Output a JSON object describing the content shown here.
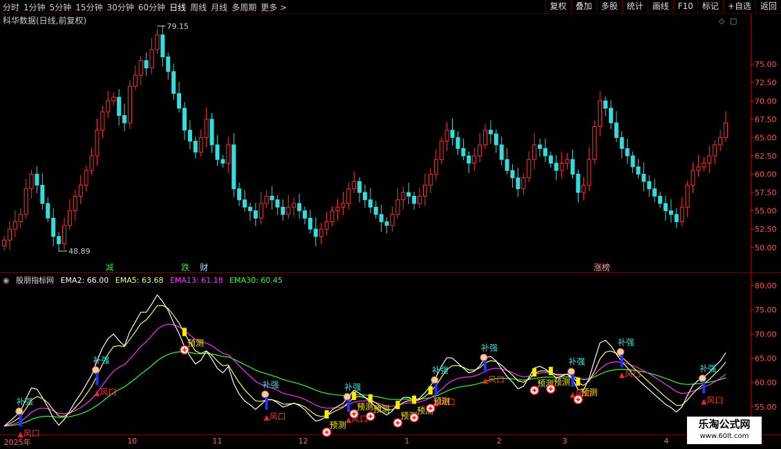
{
  "toolbar": {
    "periods": [
      "分时",
      "1分钟",
      "5分钟",
      "15分钟",
      "30分钟",
      "60分钟",
      "日线",
      "周线",
      "月线",
      "多周期",
      "更多 >"
    ],
    "active": "日线",
    "right_buttons": [
      "复权",
      "叠加",
      "多股",
      "统计",
      "画线",
      "F10",
      "标记",
      "+自选",
      "返回"
    ]
  },
  "chart_title": "科华数据(日线,前复权)",
  "price_high_label": "79.15",
  "price_low_label": "48.89",
  "price_axis_ticks": [
    "75.00",
    "72.50",
    "70.00",
    "67.50",
    "65.00",
    "62.50",
    "60.00",
    "57.50",
    "55.00",
    "52.50",
    "50.00"
  ],
  "indicator_axis_ticks": [
    "80.00",
    "75.00",
    "70.00",
    "65.00",
    "60.00",
    "55.00"
  ],
  "events": [
    {
      "label": "减",
      "color": "#33dd33",
      "x": 0.135
    },
    {
      "label": "跌",
      "color": "#33dd33",
      "x": 0.232
    },
    {
      "label": "财",
      "color": "#aaddff",
      "x": 0.256
    },
    {
      "label": "涨榜",
      "color": "#ff9999",
      "x": 0.76
    }
  ],
  "indicator": {
    "name": "股朋指标网",
    "ema2_label": "EMA2: 66.00",
    "ema5_label": "EMA5: 63.68",
    "ema13_label": "EMA13: 61.18",
    "ema30_label": "EMA30: 60.45"
  },
  "signal_texts": {
    "bu": "补强",
    "feng": "风口",
    "yu": "预测"
  },
  "x_axis_labels": [
    {
      "text": "2025年",
      "x": 0.005
    },
    {
      "text": "10",
      "x": 0.163
    },
    {
      "text": "11",
      "x": 0.272
    },
    {
      "text": "12",
      "x": 0.382
    },
    {
      "text": "1",
      "x": 0.518
    },
    {
      "text": "2",
      "x": 0.636
    },
    {
      "text": "3",
      "x": 0.72
    },
    {
      "text": "4",
      "x": 0.85
    }
  ],
  "colors": {
    "up": "#ff3333",
    "down": "#33dddd",
    "ema2": "#ffffff",
    "ema5": "#ffff66",
    "ema13": "#ff33ff",
    "ema30": "#33ff33"
  },
  "chart_data": {
    "type": "candlestick",
    "price_range": [
      48.89,
      79.15
    ],
    "closes": [
      51.0,
      52.5,
      53.5,
      54.5,
      58.0,
      60.0,
      58.5,
      56.0,
      54.0,
      51.5,
      50.5,
      53.0,
      55.0,
      57.0,
      58.5,
      60.5,
      62.5,
      66.0,
      68.5,
      70.0,
      70.5,
      68.0,
      67.0,
      72.0,
      73.5,
      75.5,
      74.5,
      77.0,
      79.0,
      76.0,
      74.0,
      71.0,
      69.0,
      66.0,
      64.5,
      63.0,
      65.0,
      67.5,
      64.0,
      62.0,
      61.5,
      64.0,
      58.0,
      56.5,
      55.5,
      55.0,
      54.0,
      56.0,
      57.0,
      56.5,
      55.5,
      54.5,
      55.5,
      56.0,
      55.0,
      54.0,
      52.5,
      51.5,
      52.5,
      53.5,
      55.0,
      55.5,
      56.0,
      58.0,
      59.0,
      57.5,
      56.5,
      55.5,
      54.5,
      53.5,
      53.0,
      54.5,
      56.5,
      57.5,
      57.0,
      56.0,
      57.0,
      58.5,
      60.0,
      62.0,
      64.5,
      66.0,
      65.0,
      63.5,
      62.5,
      61.5,
      62.5,
      64.0,
      66.0,
      65.5,
      64.0,
      62.0,
      60.5,
      59.5,
      58.0,
      59.5,
      62.0,
      64.0,
      63.5,
      62.5,
      61.5,
      60.5,
      61.5,
      62.0,
      60.0,
      57.5,
      58.5,
      62.0,
      66.5,
      70.0,
      69.0,
      67.0,
      65.0,
      63.5,
      62.5,
      61.0,
      60.0,
      59.0,
      58.0,
      57.0,
      56.0,
      55.0,
      54.5,
      53.5,
      55.5,
      58.5,
      60.5,
      61.0,
      61.5,
      62.5,
      64.0,
      65.0,
      67.0
    ]
  }
}
